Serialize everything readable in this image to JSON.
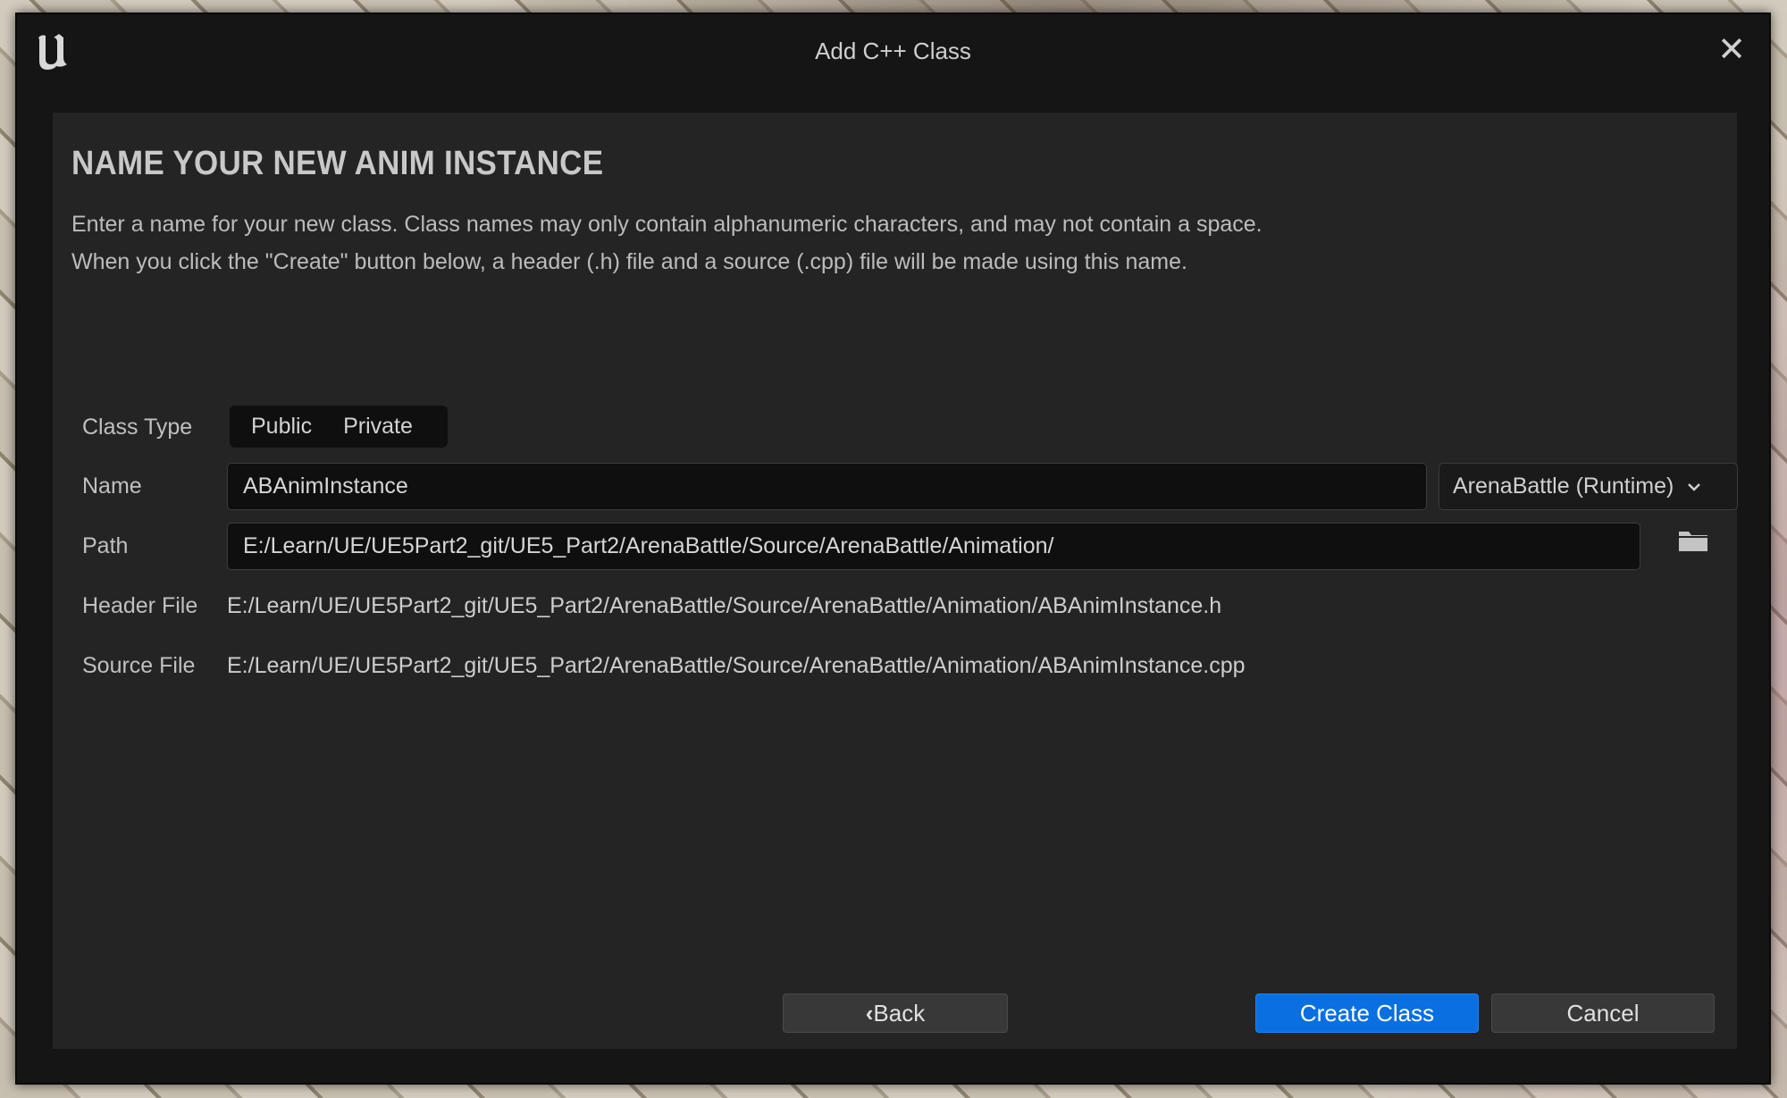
{
  "window": {
    "title": "Add C++ Class",
    "close_icon": "close-icon"
  },
  "page": {
    "heading": "NAME YOUR NEW ANIM INSTANCE",
    "description_line1": "Enter a name for your new class. Class names may only contain alphanumeric characters, and may not contain a space.",
    "description_line2": "When you click the \"Create\" button below, a header (.h) file and a source (.cpp) file will be made using this name."
  },
  "form": {
    "class_type_label": "Class Type",
    "class_type_options": [
      "Public",
      "Private"
    ],
    "name_label": "Name",
    "name_value": "ABAnimInstance",
    "module_selected": "ArenaBattle (Runtime)",
    "path_label": "Path",
    "path_value": "E:/Learn/UE/UE5Part2_git/UE5_Part2/ArenaBattle/Source/ArenaBattle/Animation/",
    "header_file_label": "Header File",
    "header_file_value": "E:/Learn/UE/UE5Part2_git/UE5_Part2/ArenaBattle/Source/ArenaBattle/Animation/ABAnimInstance.h",
    "source_file_label": "Source File",
    "source_file_value": "E:/Learn/UE/UE5Part2_git/UE5_Part2/ArenaBattle/Source/ArenaBattle/Animation/ABAnimInstance.cpp"
  },
  "buttons": {
    "back": "Back",
    "create": "Create Class",
    "cancel": "Cancel"
  },
  "colors": {
    "accent": "#0a6fe0",
    "panel": "#242424",
    "window": "#151515"
  }
}
